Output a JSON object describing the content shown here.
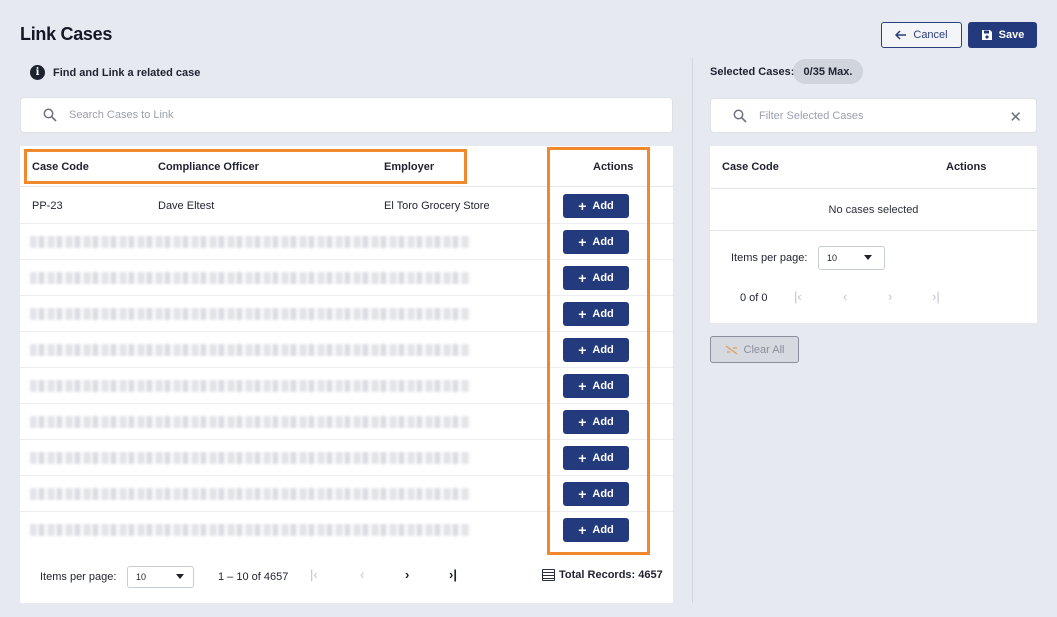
{
  "page": {
    "title": "Link Cases"
  },
  "header": {
    "cancel_label": "Cancel",
    "save_label": "Save"
  },
  "info": {
    "text": "Find and Link a related case"
  },
  "search": {
    "placeholder": "Search Cases to Link"
  },
  "table": {
    "columns": {
      "case_code": "Case Code",
      "compliance_officer": "Compliance Officer",
      "employer": "Employer",
      "actions": "Actions"
    },
    "rows": [
      {
        "case_code": "PP-23",
        "compliance_officer": "Dave Eltest",
        "employer": "El Toro Grocery Store",
        "action": "Add"
      },
      {
        "action": "Add"
      },
      {
        "action": "Add"
      },
      {
        "action": "Add"
      },
      {
        "action": "Add"
      },
      {
        "action": "Add"
      },
      {
        "action": "Add"
      },
      {
        "action": "Add"
      },
      {
        "action": "Add"
      },
      {
        "action": "Add"
      }
    ],
    "footer": {
      "items_per_page_label": "Items per page:",
      "items_per_page_value": "10",
      "range": "1 – 10 of 4657",
      "total_records": "Total Records: 4657"
    }
  },
  "selected": {
    "label": "Selected Cases:",
    "badge": "0/35 Max.",
    "filter_placeholder": "Filter Selected Cases",
    "columns": {
      "case_code": "Case Code",
      "actions": "Actions"
    },
    "empty_text": "No cases selected",
    "items_per_page_label": "Items per page:",
    "items_per_page_value": "10",
    "range": "0 of 0",
    "clear_label": "Clear All"
  },
  "colors": {
    "primary": "#233a7c",
    "highlight": "#f0892e",
    "background": "#e6e9ef"
  }
}
